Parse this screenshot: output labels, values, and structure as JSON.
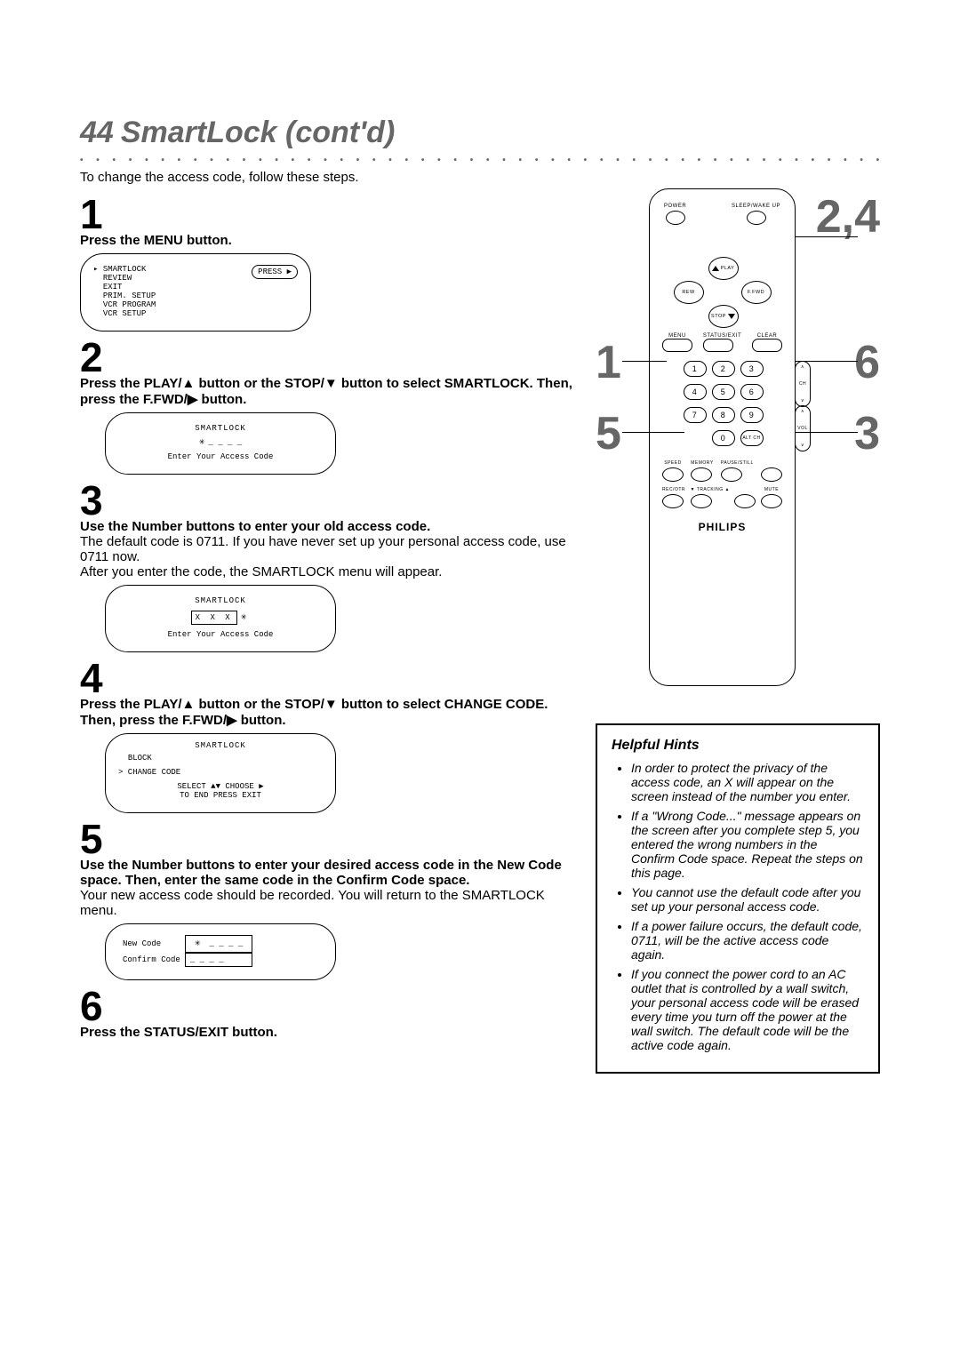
{
  "page_number": "44",
  "title": "SmartLock (cont'd)",
  "intro": "To change the access code, follow these steps.",
  "steps": {
    "s1": {
      "num": "1",
      "title": "Press the MENU button."
    },
    "s2": {
      "num": "2",
      "title": "Press the PLAY/▲ button or the STOP/▼ button to select SMARTLOCK. Then, press the F.FWD/▶ button."
    },
    "s3": {
      "num": "3",
      "title": "Use the Number buttons to enter your old access code.",
      "body1": "The default code is 0711. If you have never set up your personal access code, use 0711 now.",
      "body2": "After you enter the code, the SMARTLOCK menu will appear."
    },
    "s4": {
      "num": "4",
      "title": "Press the PLAY/▲ button or the STOP/▼ button to select CHANGE CODE. Then, press the F.FWD/▶ button."
    },
    "s5": {
      "num": "5",
      "title": "Use the Number buttons to enter your desired access code in the New Code space. Then, enter the same code in the Confirm Code space.",
      "body": "Your new access code should be recorded. You will return to the SMARTLOCK menu."
    },
    "s6": {
      "num": "6",
      "title": "Press the STATUS/EXIT button."
    }
  },
  "osd": {
    "main_menu": {
      "items": [
        "SMARTLOCK",
        "REVIEW",
        "EXIT",
        "PRIM. SETUP",
        "VCR PROGRAM",
        "VCR SETUP"
      ],
      "press_label": "PRESS ▶"
    },
    "smartlock_enter": {
      "title": "SMARTLOCK",
      "placeholder": "_ _ _ _",
      "prompt": "Enter Your Access Code"
    },
    "smartlock_entered": {
      "title": "SMARTLOCK",
      "code": "X  X  X",
      "prompt": "Enter Your Access Code"
    },
    "smartlock_menu": {
      "title": "SMARTLOCK",
      "block": "BLOCK",
      "change": "> CHANGE CODE",
      "footer1": "SELECT ▲▼ CHOOSE ▶",
      "footer2": "TO END PRESS EXIT"
    },
    "change_code": {
      "new_label": "New Code",
      "new_value": "_ _ _ _",
      "confirm_label": "Confirm Code",
      "confirm_value": "_ _ _ _"
    }
  },
  "remote": {
    "power": "POWER",
    "sleep": "SLEEP/WAKE UP",
    "play": "PLAY",
    "rew": "REW",
    "ffwd": "F.FWD",
    "stop": "STOP",
    "menu": "MENU",
    "status": "STATUS/EXIT",
    "clear": "CLEAR",
    "nums": [
      "1",
      "2",
      "3",
      "4",
      "5",
      "6",
      "7",
      "8",
      "9",
      "0"
    ],
    "ch": "CH",
    "vol": "VOL",
    "altch": "ALT CH",
    "row4": [
      "SPEED",
      "MEMORY",
      "PAUSE/STILL",
      ""
    ],
    "row5": [
      "REC/OTR",
      "▼ TRACKING ▲",
      "",
      "MUTE"
    ],
    "brand": "PHILIPS",
    "callouts": {
      "c1": "1",
      "c24": "2,4",
      "c3": "3",
      "c5": "5",
      "c6": "6"
    }
  },
  "hints": {
    "title": "Helpful Hints",
    "items": [
      "In order to protect the privacy of the access code, an X will appear on the screen instead of the number you enter.",
      "If a \"Wrong Code...\" message appears on the screen after you complete step 5, you entered the wrong numbers in the Confirm Code space. Repeat the steps on this page.",
      "You cannot use the default code after you set up your personal access code.",
      "If a power failure occurs, the default code, 0711, will be the active access code again.",
      "If you connect the power cord to an AC outlet that is controlled by a wall switch, your personal access code will be erased every time you turn off the power at the wall switch. The default code will be the active code again."
    ]
  }
}
